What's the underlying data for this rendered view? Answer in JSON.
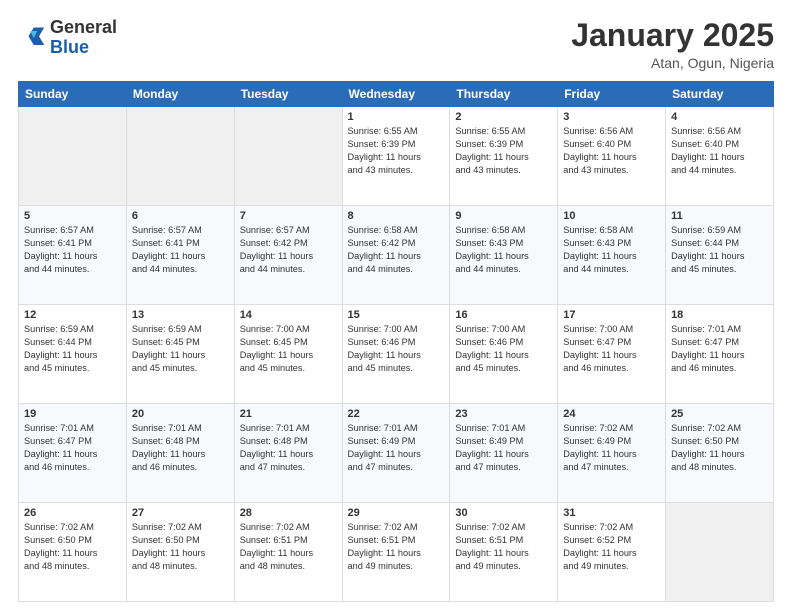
{
  "header": {
    "logo_general": "General",
    "logo_blue": "Blue",
    "title_month": "January 2025",
    "title_location": "Atan, Ogun, Nigeria"
  },
  "weekdays": [
    "Sunday",
    "Monday",
    "Tuesday",
    "Wednesday",
    "Thursday",
    "Friday",
    "Saturday"
  ],
  "weeks": [
    [
      {
        "day": "",
        "info": ""
      },
      {
        "day": "",
        "info": ""
      },
      {
        "day": "",
        "info": ""
      },
      {
        "day": "1",
        "info": "Sunrise: 6:55 AM\nSunset: 6:39 PM\nDaylight: 11 hours\nand 43 minutes."
      },
      {
        "day": "2",
        "info": "Sunrise: 6:55 AM\nSunset: 6:39 PM\nDaylight: 11 hours\nand 43 minutes."
      },
      {
        "day": "3",
        "info": "Sunrise: 6:56 AM\nSunset: 6:40 PM\nDaylight: 11 hours\nand 43 minutes."
      },
      {
        "day": "4",
        "info": "Sunrise: 6:56 AM\nSunset: 6:40 PM\nDaylight: 11 hours\nand 44 minutes."
      }
    ],
    [
      {
        "day": "5",
        "info": "Sunrise: 6:57 AM\nSunset: 6:41 PM\nDaylight: 11 hours\nand 44 minutes."
      },
      {
        "day": "6",
        "info": "Sunrise: 6:57 AM\nSunset: 6:41 PM\nDaylight: 11 hours\nand 44 minutes."
      },
      {
        "day": "7",
        "info": "Sunrise: 6:57 AM\nSunset: 6:42 PM\nDaylight: 11 hours\nand 44 minutes."
      },
      {
        "day": "8",
        "info": "Sunrise: 6:58 AM\nSunset: 6:42 PM\nDaylight: 11 hours\nand 44 minutes."
      },
      {
        "day": "9",
        "info": "Sunrise: 6:58 AM\nSunset: 6:43 PM\nDaylight: 11 hours\nand 44 minutes."
      },
      {
        "day": "10",
        "info": "Sunrise: 6:58 AM\nSunset: 6:43 PM\nDaylight: 11 hours\nand 44 minutes."
      },
      {
        "day": "11",
        "info": "Sunrise: 6:59 AM\nSunset: 6:44 PM\nDaylight: 11 hours\nand 45 minutes."
      }
    ],
    [
      {
        "day": "12",
        "info": "Sunrise: 6:59 AM\nSunset: 6:44 PM\nDaylight: 11 hours\nand 45 minutes."
      },
      {
        "day": "13",
        "info": "Sunrise: 6:59 AM\nSunset: 6:45 PM\nDaylight: 11 hours\nand 45 minutes."
      },
      {
        "day": "14",
        "info": "Sunrise: 7:00 AM\nSunset: 6:45 PM\nDaylight: 11 hours\nand 45 minutes."
      },
      {
        "day": "15",
        "info": "Sunrise: 7:00 AM\nSunset: 6:46 PM\nDaylight: 11 hours\nand 45 minutes."
      },
      {
        "day": "16",
        "info": "Sunrise: 7:00 AM\nSunset: 6:46 PM\nDaylight: 11 hours\nand 45 minutes."
      },
      {
        "day": "17",
        "info": "Sunrise: 7:00 AM\nSunset: 6:47 PM\nDaylight: 11 hours\nand 46 minutes."
      },
      {
        "day": "18",
        "info": "Sunrise: 7:01 AM\nSunset: 6:47 PM\nDaylight: 11 hours\nand 46 minutes."
      }
    ],
    [
      {
        "day": "19",
        "info": "Sunrise: 7:01 AM\nSunset: 6:47 PM\nDaylight: 11 hours\nand 46 minutes."
      },
      {
        "day": "20",
        "info": "Sunrise: 7:01 AM\nSunset: 6:48 PM\nDaylight: 11 hours\nand 46 minutes."
      },
      {
        "day": "21",
        "info": "Sunrise: 7:01 AM\nSunset: 6:48 PM\nDaylight: 11 hours\nand 47 minutes."
      },
      {
        "day": "22",
        "info": "Sunrise: 7:01 AM\nSunset: 6:49 PM\nDaylight: 11 hours\nand 47 minutes."
      },
      {
        "day": "23",
        "info": "Sunrise: 7:01 AM\nSunset: 6:49 PM\nDaylight: 11 hours\nand 47 minutes."
      },
      {
        "day": "24",
        "info": "Sunrise: 7:02 AM\nSunset: 6:49 PM\nDaylight: 11 hours\nand 47 minutes."
      },
      {
        "day": "25",
        "info": "Sunrise: 7:02 AM\nSunset: 6:50 PM\nDaylight: 11 hours\nand 48 minutes."
      }
    ],
    [
      {
        "day": "26",
        "info": "Sunrise: 7:02 AM\nSunset: 6:50 PM\nDaylight: 11 hours\nand 48 minutes."
      },
      {
        "day": "27",
        "info": "Sunrise: 7:02 AM\nSunset: 6:50 PM\nDaylight: 11 hours\nand 48 minutes."
      },
      {
        "day": "28",
        "info": "Sunrise: 7:02 AM\nSunset: 6:51 PM\nDaylight: 11 hours\nand 48 minutes."
      },
      {
        "day": "29",
        "info": "Sunrise: 7:02 AM\nSunset: 6:51 PM\nDaylight: 11 hours\nand 49 minutes."
      },
      {
        "day": "30",
        "info": "Sunrise: 7:02 AM\nSunset: 6:51 PM\nDaylight: 11 hours\nand 49 minutes."
      },
      {
        "day": "31",
        "info": "Sunrise: 7:02 AM\nSunset: 6:52 PM\nDaylight: 11 hours\nand 49 minutes."
      },
      {
        "day": "",
        "info": ""
      }
    ]
  ]
}
